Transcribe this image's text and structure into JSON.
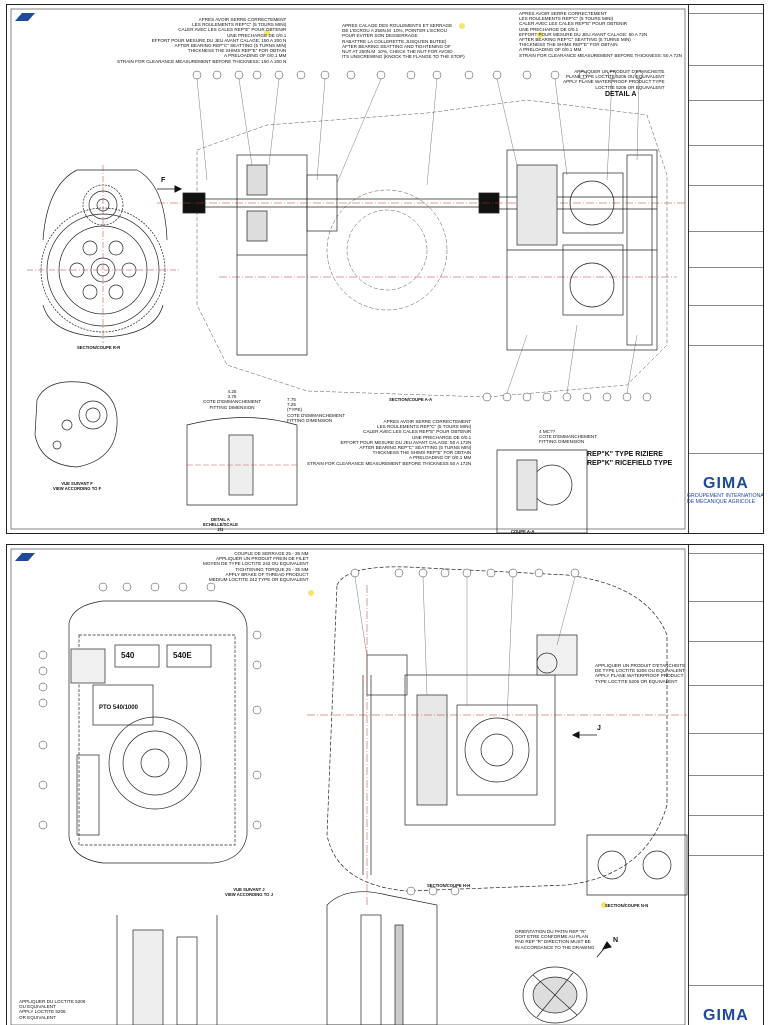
{
  "sheet1": {
    "notes": {
      "bearing_top_left": "APRES AVOIR SERRE CORRECTEMENT\nLES ROULEMENTS REP\"C\" (5 TOURS MINI)\nCALER AVEC LES CALES REP\"E\" POUR OBTENIR\nUNE PRECHARGE DE 0/0.1\nEFFORT POUR MESURE DU JEU AVANT CALAGE: 150 A 200 N\nAFTER BEARING REP\"C\" SEATTING (5 TURNS MIN)\nTHICKNESS THE SHIMS REP\"E\" FOR OBTAIN\nA PRELOADING OF 0/0.1 mm\nSTRAIN FOR CLEARANCE MEASUREMENT BEFORE THICKNESS: 150 A 200 N",
      "nut_middle": "APRES CALAGE DES ROULEMENTS ET SERRAGE\nDE L'ECROU A 250N.m  10%, POINTER L'ECROU\nPOUR EVITER SON DESSERRAGE\nRABATTRE LA COLLERETTE JUSQU'EN BUTEE)\nAFTER BEARING SEATTING AND TIGHTENING OF\nNUT AT 250N.m  10%, CHECK THE NUT FOR AVOID\nITS UNSCREWING (KNOCK THE FLANGE TO THE STOP)",
      "bearing_top_right": "APRES AVOIR SERRE CORRECTEMENT\nLES ROULEMENTS REP\"C\" (5 TOURS MINI)\nCALER AVEC LES CALES REP\"E\" POUR OBTENIR\nUNE PRECHARGE DE 0/0.1\nEFFORT POUR MESURE DU JEU AVANT CALAGE: 50 A 72N\nAFTER BEARING REP\"C\" SEATTING (5 TURNS MIN)\nTHICKNESS THE SHIMS REP\"E\" FOR OBTAIN\nA PRELOADING OF 0/0.1 mm\nSTRAIN FOR CLEARANCE MEASUREMENT BEFORE THICKNESS: 50 A 72N",
      "sealant": "APPLIQUER UN PRODUIT D'ETANCHEITE\nPLANE TYPE LOCTITE 5206 OU EQUIVALENT\nAPPLY PLANE WATERPROOF PRODUCT TYPE\nLOCTITE 5206 OR EQUIVALENT",
      "bearing_bottom": "APRES AVOIR SERRE CORRECTEMENT\nLES ROULEMENTS REP\"C\" (5 TOURS MINI)\nCALER AVEC LES CALES REP\"E\" POUR OBTENIR\nUNE PRECHARGE DE 0/0.1\nEFFORT POUR MESURE DU JEU AVANT CALAGE: 50 A 172N\nAFTER BEARING REP\"C\" SEATTING (5 TURNS MIN)\nTHICKNESS THE SHIMS REP\"E\" FOR OBTAIN\nA PRELOADING OF 0/0.1 mm\nSTRAIN FOR CLEARANCE MEASUREMENT BEFORE THICKNESS 50 A 172N",
      "fitting_left": "4.25\n3.75\nCOTE D'EMMANCHEMENT\nFITTING DIMENSION",
      "fitting_mid": "7.75\n7.25\n(TYPE)\nCOTE D'EMMANCHEMENT\nFITTING DIMENSION",
      "fitting_right": "4 MC??\nCOTE D'EMMANCHEMENT\nFITTING DIMENSION"
    },
    "labels": {
      "detail_a": "DETAIL A",
      "section_rr": "SECTION/COUPE R-R",
      "section_aa": "SECTION/COUPE A-A",
      "view_f": "VUE SUIVANT F\nVIEW ACCORDING TO F",
      "detail_a_scale": "DETAIL A\nECHELLE/SCALE\n2/1",
      "coupe_aa": "COUPE A-A",
      "rep_k_riziere": "REP\"K\" TYPE RIZIERE",
      "rep_k_ricefield": "REP\"K\" RICEFIELD TYPE",
      "arrow_f": "F"
    },
    "gima": {
      "logo": "GIMA",
      "subtitle": "GROUPEMENT INTERNATIONAL\nDE MECANIQUE AGRICOLE"
    }
  },
  "sheet2": {
    "notes": {
      "torque": "COUPLE DE SERRAGE 25 - 35 Nm\nAPPLIQUER UN PRODUIT FREIN DE FILET\nMOYEN DE TYPE LOCTITE 242 OU EQUIVALENT\nTIGHTENING TORQUE 25 - 35 Nm\nAPPLY BRAKE OF THREAD PRODUCT\nMEDIUM LOCTITE 242 TYPE OR EQUIVALENT",
      "sealant": "APPLIQUER UN PRODUIT D'ETANCHEITE\nDE TYPE LOCTITE 5206 OU EQUIVALENT\nAPPLY PLANE WATERPROOF PRODUCT\nTYPE LOCTITE 5206 OR EQUIVALENT",
      "orientation": "ORIENTATION DU PATIN REP \"R\"\nDOIT ETRE CONFORME AU PLAN\nPAD REP \"R\" DIRECTION MUST BE\nIN ACCORDANCE TO THE DRAWING",
      "loctite_bottom": "APPLIQUER DU LOCTITE 5206\nOU EQUIVALENT\nAPPLY LOCTITE 5206\nOR EQUIVALENT"
    },
    "labels": {
      "view_j": "VUE SUIVANT J\nVIEW ACCORDING TO J",
      "section_hh": "SECTION/COUPE H-H",
      "section_nn": "SECTION/COUPE N-N",
      "pto_540": "540",
      "pto_540e": "540E",
      "pto_label": "PTO 540/1000",
      "arrow_j": "J",
      "arrow_n": "N"
    },
    "gima": {
      "logo": "GIMA"
    }
  },
  "colors": {
    "line": "#222222",
    "centerline": "#c0392b",
    "highlight": "#f5e66a",
    "brand": "#1e4a9a",
    "revision_text": "#1a3a8a"
  }
}
